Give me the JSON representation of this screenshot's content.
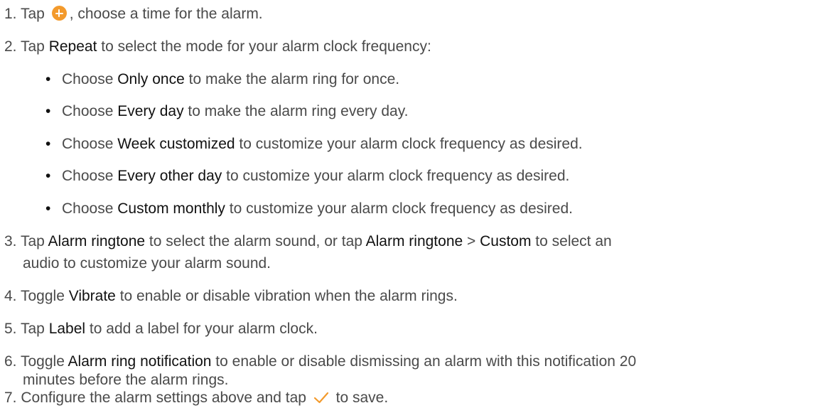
{
  "steps": [
    {
      "num": "1.",
      "parts": [
        "Tap",
        ", choose a time for the alarm."
      ]
    },
    {
      "num": "2.",
      "parts": [
        "Tap ",
        "Repeat",
        " to select the mode for your alarm clock frequency:"
      ]
    },
    {
      "num": "3.",
      "parts": [
        "Tap ",
        "Alarm ringtone",
        " to select the alarm sound, or tap ",
        "Alarm ringtone",
        " > ",
        "Custom",
        " to select an"
      ],
      "cont": "audio to customize your alarm sound."
    },
    {
      "num": "4.",
      "parts": [
        "Toggle ",
        "Vibrate",
        " to enable or disable vibration when the alarm rings."
      ]
    },
    {
      "num": "5.",
      "parts": [
        "Tap ",
        "Label",
        " to add a label for your alarm clock."
      ]
    },
    {
      "num": "6.",
      "parts": [
        "Toggle ",
        "Alarm ring notification",
        " to enable or disable dismissing an alarm with this notification 20"
      ],
      "cont": "minutes before the alarm rings."
    },
    {
      "num": "7.",
      "parts": [
        "Configure the alarm settings above and tap",
        "to save."
      ]
    }
  ],
  "repeat_options": [
    {
      "bullet": "•",
      "pre": "Choose ",
      "term": "Only once",
      "post": " to make the alarm ring for once."
    },
    {
      "bullet": "•",
      "pre": "Choose ",
      "term": "Every day",
      "post": " to make the alarm ring every day."
    },
    {
      "bullet": "•",
      "pre": "Choose ",
      "term": "Week customized",
      "post": " to customize your alarm clock frequency as desired."
    },
    {
      "bullet": "•",
      "pre": "Choose ",
      "term": "Every other day",
      "post": " to customize your alarm clock frequency as desired."
    },
    {
      "bullet": "•",
      "pre": "Choose ",
      "term": "Custom monthly",
      "post": " to customize your alarm clock frequency as desired."
    }
  ],
  "icons": {
    "add": "plus-circle-icon",
    "confirm": "checkmark-icon"
  },
  "colors": {
    "accent": "#f39a2c",
    "text": "#4a4a4a",
    "emphasis": "#111111"
  }
}
